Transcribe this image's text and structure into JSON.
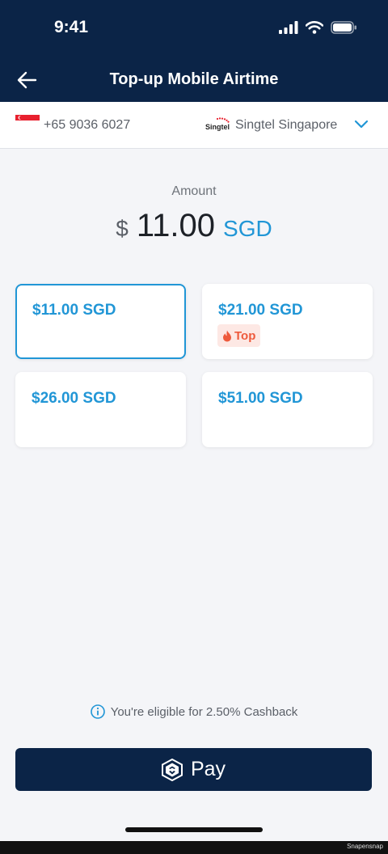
{
  "status_bar": {
    "time": "9:41"
  },
  "header": {
    "title": "Top-up Mobile Airtime"
  },
  "carrier_bar": {
    "phone_number": "+65 9036 6027",
    "carrier_logo_text": "Singtel",
    "carrier_name": "Singtel Singapore"
  },
  "amount": {
    "label": "Amount",
    "currency_symbol": "$",
    "value": "11.00",
    "currency_code": "SGD"
  },
  "options": [
    {
      "label": "$11.00 SGD",
      "selected": true
    },
    {
      "label": "$21.00 SGD",
      "badge": "Top"
    },
    {
      "label": "$26.00 SGD"
    },
    {
      "label": "$51.00 SGD"
    }
  ],
  "cashback": {
    "text": "You're eligible for 2.50% Cashback"
  },
  "pay_button": {
    "label": "Pay"
  },
  "watermark": "Snapensnap",
  "colors": {
    "header_bg": "#0b2447",
    "accent": "#2196d6",
    "badge_fg": "#ee5a3c",
    "badge_bg": "#fde8e4"
  },
  "icons": [
    "back-arrow-icon",
    "signal-icon",
    "wifi-icon",
    "battery-icon",
    "singapore-flag-icon",
    "chevron-down-icon",
    "flame-icon",
    "info-icon",
    "cro-logo-icon"
  ]
}
